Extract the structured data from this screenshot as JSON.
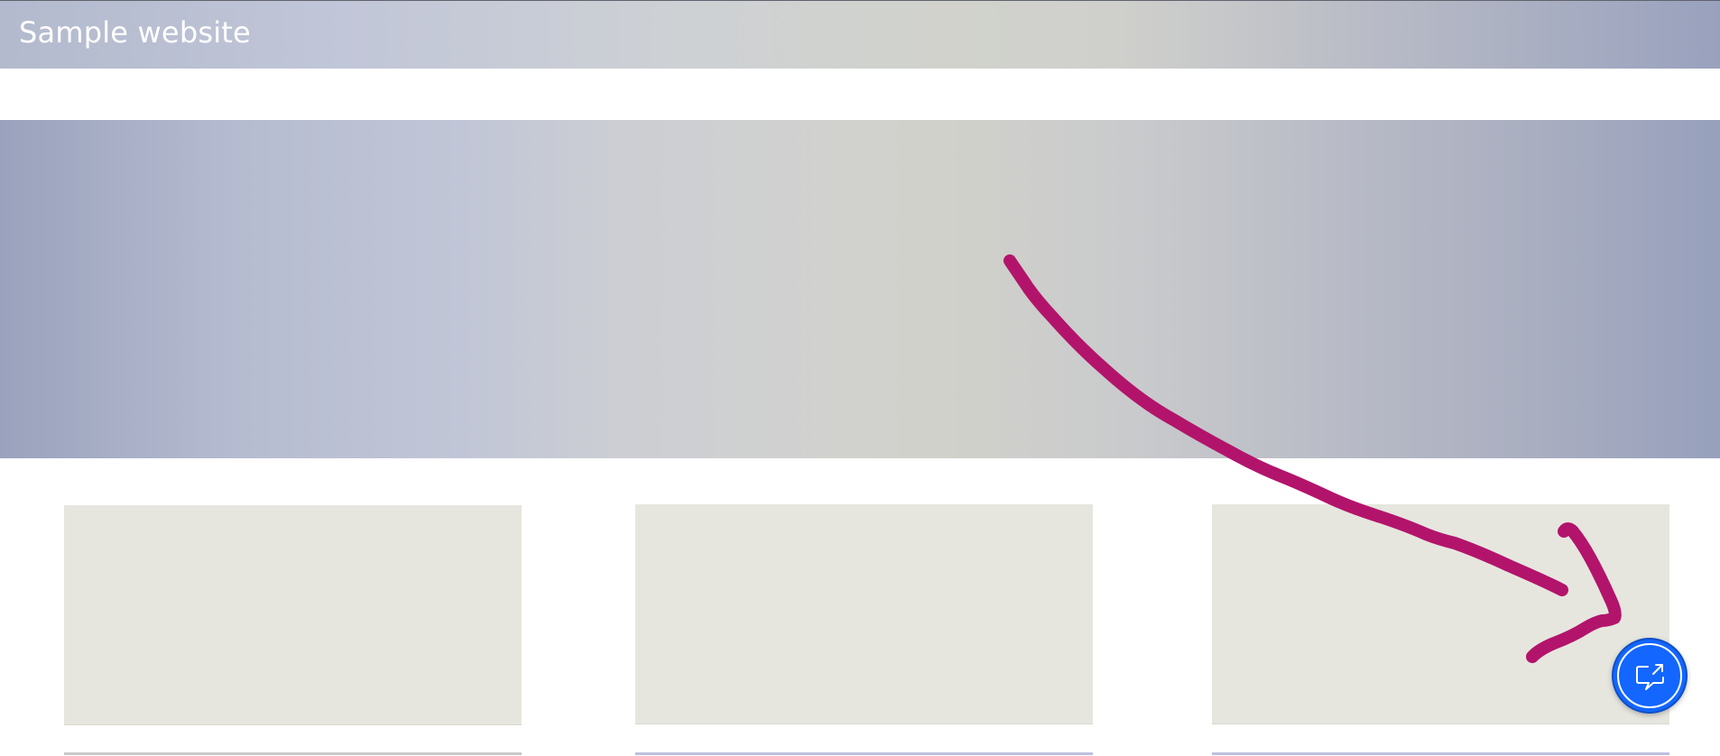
{
  "site": {
    "title": "Sample website"
  },
  "hero": {},
  "cards": [
    {
      "id": "card-1"
    },
    {
      "id": "card-2"
    },
    {
      "id": "card-3"
    }
  ],
  "annotation": {
    "type": "hand-drawn-arrow",
    "color": "#b3146b"
  },
  "fab": {
    "icon": "chat-share-icon",
    "color": "#1366ff"
  },
  "colors": {
    "header_gradient_start": "#b3bacd",
    "header_gradient_mid": "#d1d2cc",
    "header_gradient_end": "#99a1bd",
    "card_background": "#e6e6df"
  }
}
